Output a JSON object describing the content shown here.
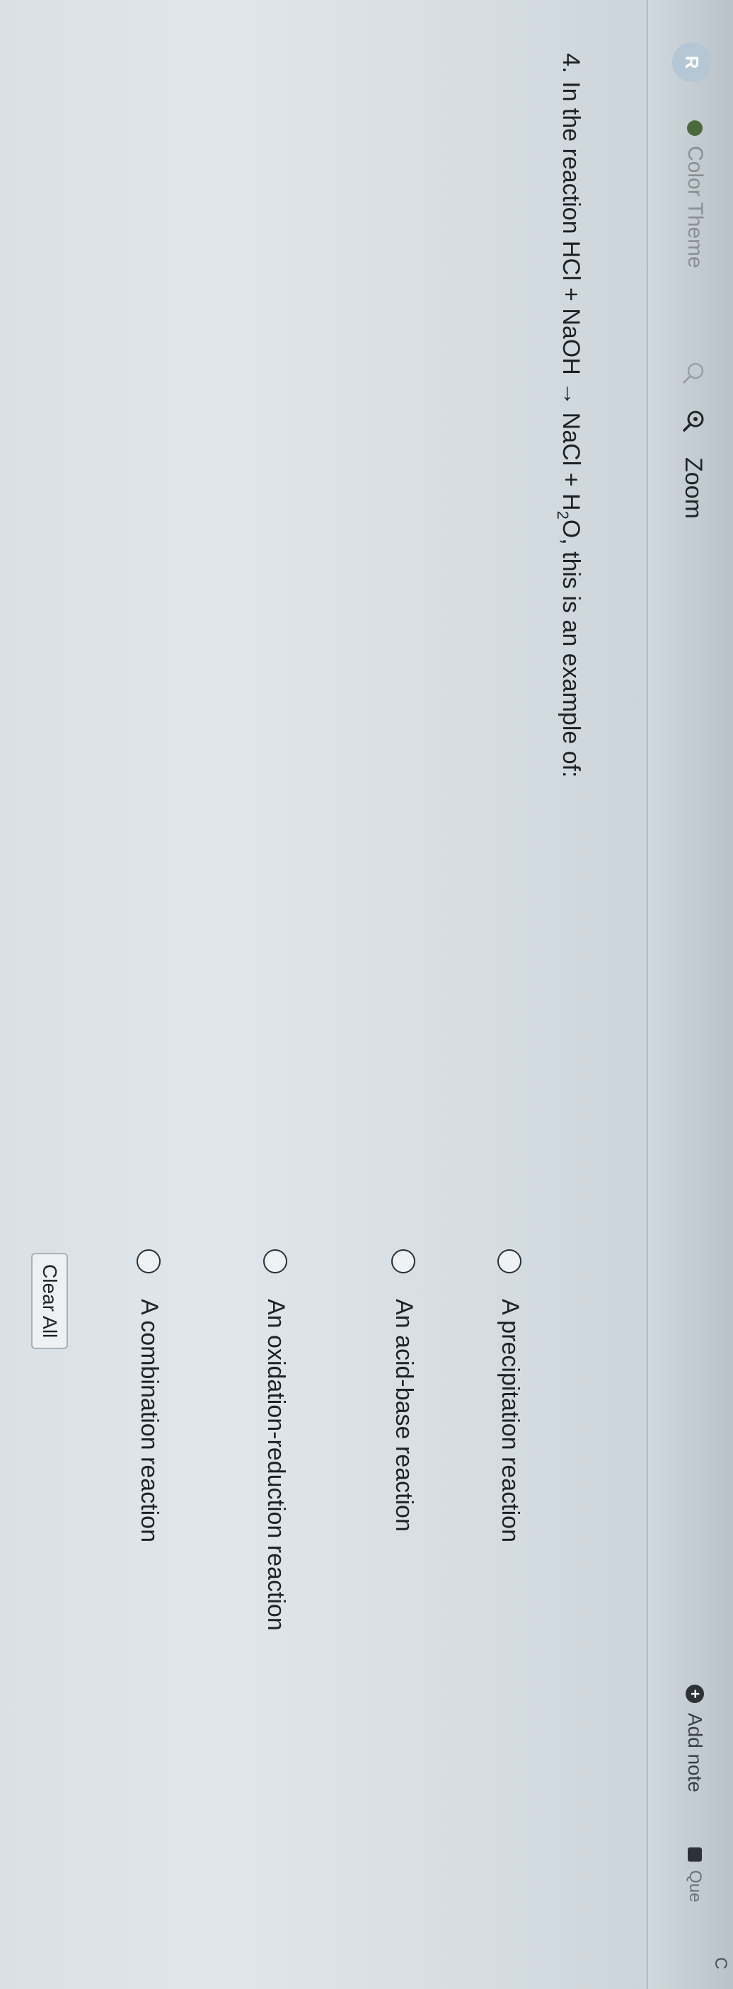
{
  "toolbar": {
    "logo_text": "R",
    "color_theme_label": "Color Theme",
    "zoom_label": "Zoom",
    "add_note_label": "Add note",
    "questions_label": "Que",
    "top_right_label": "C"
  },
  "question": {
    "number": "4.",
    "text_before": "In the reaction HCl + NaOH → NaCl + H",
    "subscript": "2",
    "text_after": "O, this is an example of:"
  },
  "options": [
    {
      "label": "A precipitation reaction",
      "selected": false
    },
    {
      "label": "An acid-base reaction",
      "selected": false
    },
    {
      "label": "An oxidation-reduction reaction",
      "selected": false
    },
    {
      "label": "A combination reaction",
      "selected": false
    }
  ],
  "clear_all_label": "Clear All",
  "icons": {
    "color_theme": "color-dot-icon",
    "zoom_out": "magnifier-minus-icon",
    "zoom_in": "magnifier-plus-icon",
    "add_note": "plus-circle-icon",
    "questions": "square-icon"
  },
  "colors": {
    "radio_border": "#2a2f34",
    "text": "#1e2226",
    "add_note_icon": "#2d3238"
  }
}
